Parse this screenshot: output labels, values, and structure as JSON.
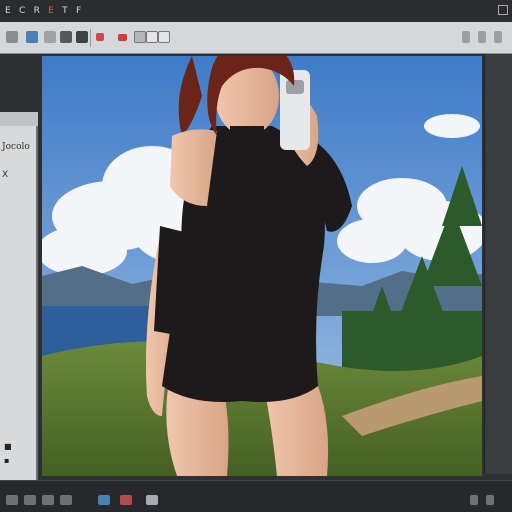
{
  "menubar": {
    "items": [
      "E",
      "C",
      "R",
      "E",
      "T",
      "F"
    ],
    "highlight_index": 3
  },
  "left_panel": {
    "label": "Jocolo",
    "icon_label": "X"
  },
  "icons": {
    "toolbar": [
      "brush-icon",
      "pen-icon",
      "layer-icon",
      "lock-icon",
      "selection-icon",
      "record-icon",
      "frame-icon",
      "frame-icon",
      "square-icon",
      "settings-icon",
      "grid-icon",
      "tool-icon"
    ],
    "bottom": [
      "layer-icon",
      "adjust-icon",
      "mask-icon",
      "group-icon",
      "image-icon",
      "trash-icon"
    ]
  },
  "colors": {
    "app_bg": "#2e3033",
    "toolbar_bg": "#d6d7d9",
    "panel_bg": "#d9dadc",
    "accent_red": "#e05a5a",
    "accent_blue": "#4d7fb3",
    "sky": "#4f86cc",
    "outfit": "#1c1a1a",
    "hair": "#6b2418"
  }
}
